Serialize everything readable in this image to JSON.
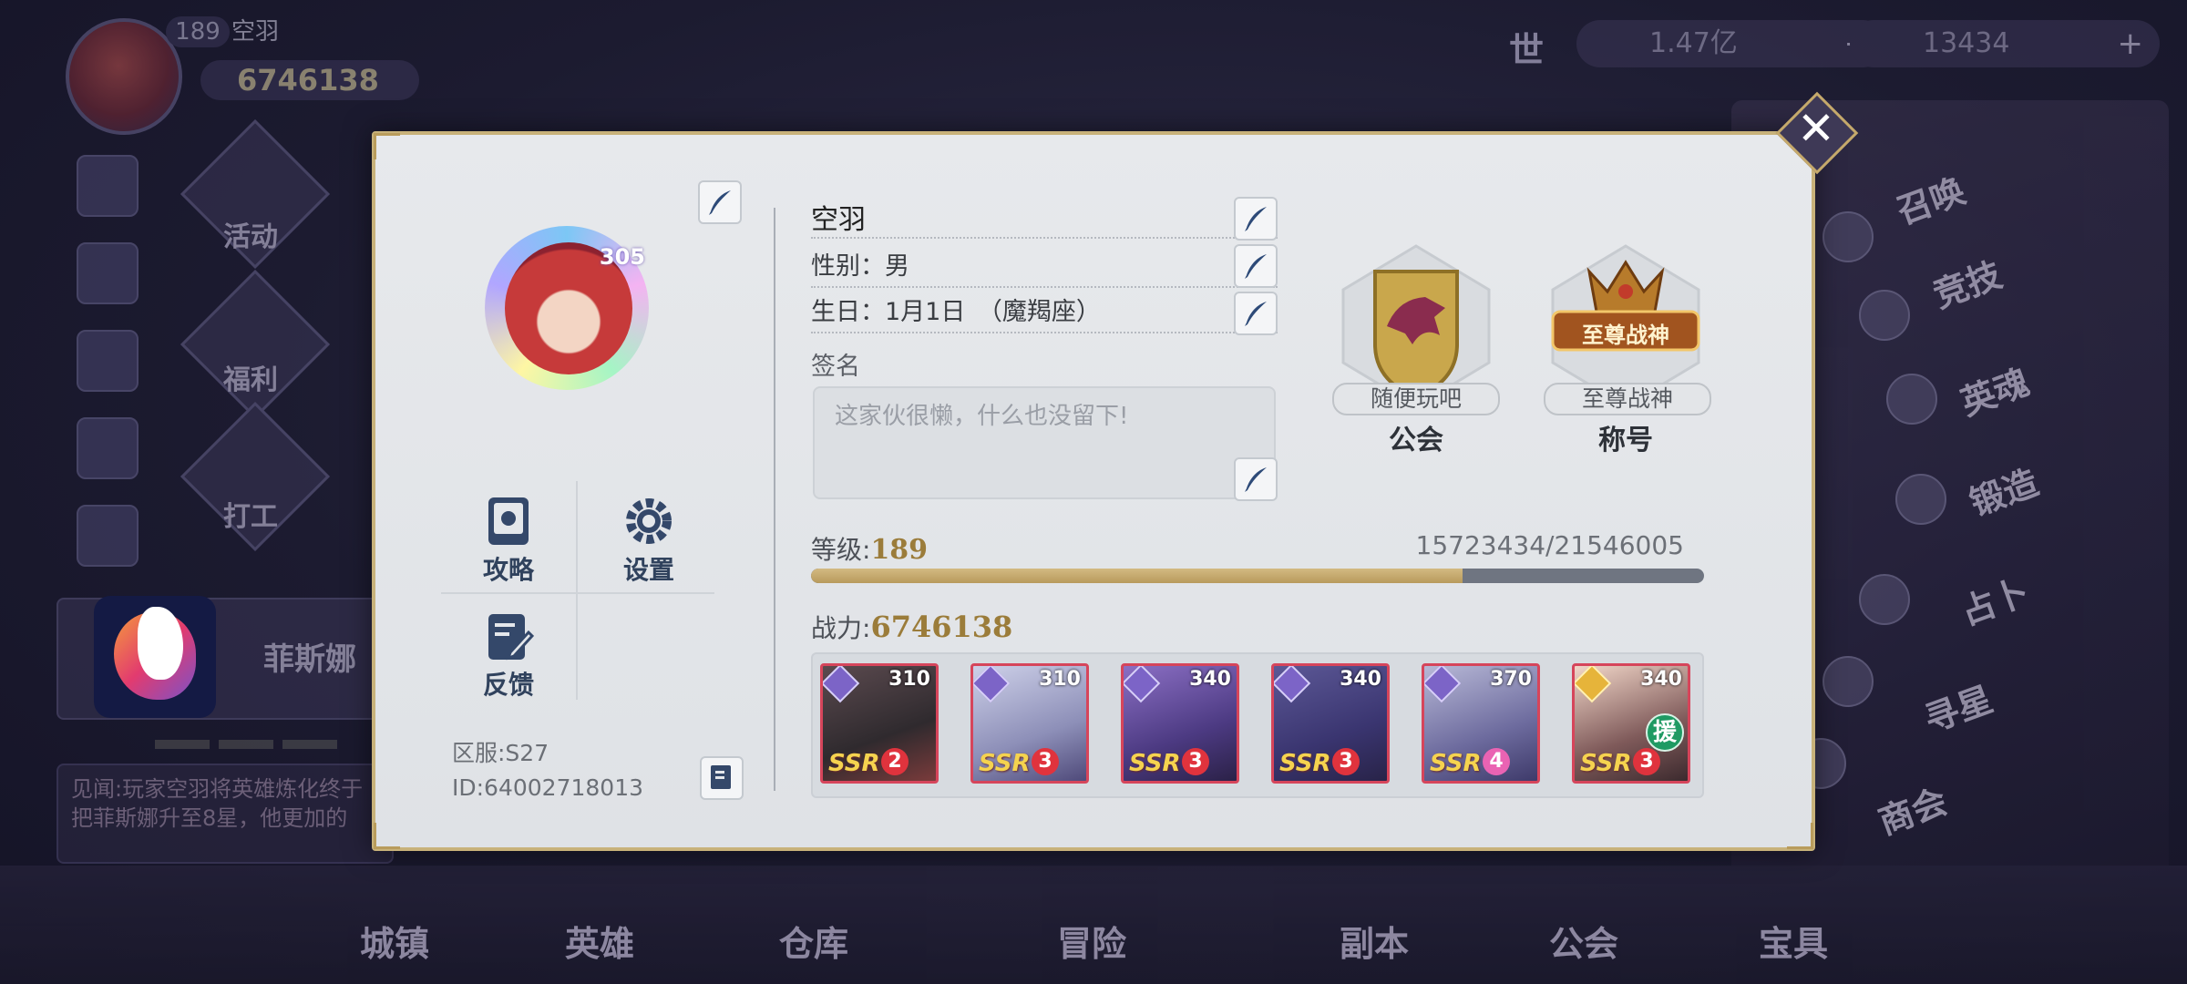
{
  "background": {
    "player_level": "189",
    "player_name": "空羽",
    "player_power": "6746138",
    "activities": [
      "活动",
      "福利",
      "打工"
    ],
    "gold": "1.47亿",
    "diamonds": "13434",
    "world_icon": "世",
    "side_menu": [
      "召唤",
      "竞技",
      "英魂",
      "锻造",
      "占卜",
      "寻星",
      "商会"
    ],
    "bottom_nav": [
      "城镇",
      "英雄",
      "仓库",
      "冒险",
      "副本",
      "公会",
      "宝具"
    ],
    "hero_card_name": "菲斯娜",
    "chat_text": "见闻:玩家空羽将英雄炼化终于把菲斯娜升至8星，他更加的"
  },
  "profile": {
    "avatar_level": "305",
    "name": "空羽",
    "gender": "性别：男",
    "birthday": "生日：1月1日　（魔羯座）",
    "signature_label": "签名",
    "signature_placeholder": "这家伙很懒，什么也没留下!",
    "menu": [
      {
        "label": "攻略",
        "icon": "book-icon"
      },
      {
        "label": "设置",
        "icon": "gear-icon"
      },
      {
        "label": "反馈",
        "icon": "feedback-icon"
      }
    ],
    "server": "区服:S27",
    "id": "ID:64002718013",
    "guild": {
      "label": "随便玩吧",
      "title": "公会"
    },
    "honor": {
      "label": "至尊战神",
      "title": "称号",
      "emblem_text": "至尊战神"
    },
    "level_label": "等级:",
    "level_value": "189",
    "exp": "15723434/21546005",
    "exp_current": 15723434,
    "exp_max": 21546005,
    "power_label": "战力:",
    "power_value": "6746138",
    "heroes": [
      {
        "level": "310",
        "rarity": "SSR",
        "stars": "2",
        "class_color": "purple",
        "assist": false
      },
      {
        "level": "310",
        "rarity": "SSR",
        "stars": "3",
        "class_color": "purple",
        "assist": false
      },
      {
        "level": "340",
        "rarity": "SSR",
        "stars": "3",
        "class_color": "purple",
        "assist": false
      },
      {
        "level": "340",
        "rarity": "SSR",
        "stars": "3",
        "class_color": "purple",
        "assist": false
      },
      {
        "level": "370",
        "rarity": "SSR",
        "stars": "4",
        "class_color": "purple",
        "assist": false
      },
      {
        "level": "340",
        "rarity": "SSR",
        "stars": "3",
        "class_color": "gold",
        "assist": true,
        "assist_label": "援"
      }
    ]
  },
  "colors": {
    "accent_gold": "#9b7c3a",
    "frame_gold": "#c8b27a",
    "xp_fill": "#c7ad70",
    "hero_border": "#d6455b"
  }
}
